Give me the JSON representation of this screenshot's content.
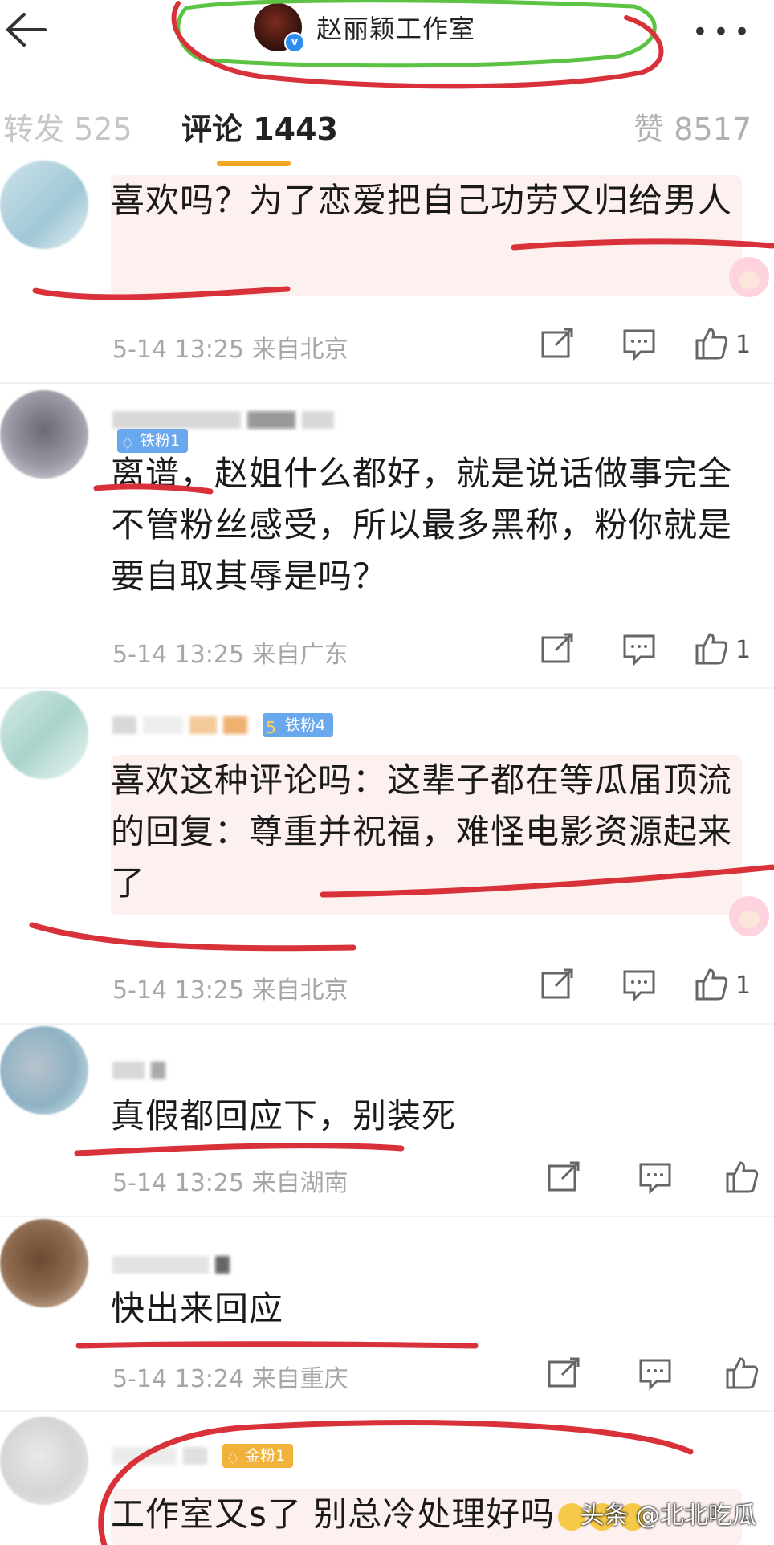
{
  "header": {
    "back_icon": "arrow-left-icon",
    "title": "赵丽颖工作室",
    "verified_mark": "v",
    "more_icon": "more-dots-icon"
  },
  "tabs": {
    "repost": "转发 525",
    "comments": "评论 1443",
    "likes": "赞 8517",
    "active_color": "#f5a623"
  },
  "comments": [
    {
      "text": "喜欢吗？为了恋爱把自己功劳又归给男人",
      "time": "5-14 13:25",
      "location": "来自北京",
      "like_count": "1"
    },
    {
      "badge": "铁粉1",
      "text": "离谱，赵姐什么都好，就是说话做事完全不管粉丝感受，所以最多黑称，粉你就是要自取其辱是吗？",
      "time": "5-14 13:25",
      "location": "来自广东",
      "like_count": "1"
    },
    {
      "badge": "铁粉4",
      "badge_level": "5",
      "text": "喜欢这种评论吗：这辈子都在等瓜届顶流的回复：尊重并祝福，难怪电影资源起来了",
      "time": "5-14 13:25",
      "location": "来自北京",
      "like_count": "1"
    },
    {
      "text": "真假都回应下，别装死",
      "time": "5-14 13:25",
      "location": "来自湖南"
    },
    {
      "text": "快出来回应",
      "time": "5-14 13:24",
      "location": "来自重庆"
    },
    {
      "badge": "金粉1",
      "text": "工作室又s了 别总冷处理好吗"
    }
  ],
  "watermark": "头条 @北北吃瓜",
  "annotation_colors": {
    "red": "#d9313a",
    "green": "#5cc243"
  }
}
